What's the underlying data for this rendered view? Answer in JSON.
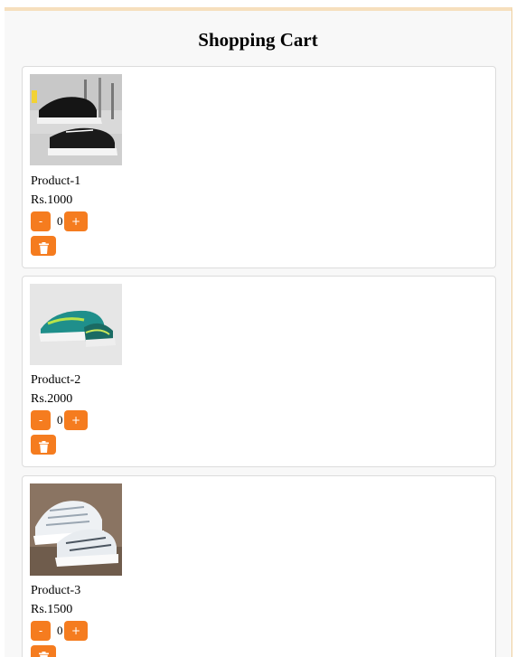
{
  "header": {
    "title": "Shopping Cart"
  },
  "theme": {
    "accent": "#f57c1f",
    "card_border": "#dcdcdc",
    "page_bg": "#f8f8f8"
  },
  "cart": {
    "items": [
      {
        "name": "Product-1",
        "price": "Rs.1000",
        "quantity": "0",
        "minus_label": "-",
        "plus_label": "+",
        "image": "black sneaker with white sole"
      },
      {
        "name": "Product-2",
        "price": "Rs.2000",
        "quantity": "0",
        "minus_label": "-",
        "plus_label": "+",
        "image": "teal and green running shoe"
      },
      {
        "name": "Product-3",
        "price": "Rs.1500",
        "quantity": "0",
        "minus_label": "-",
        "plus_label": "+",
        "image": "white and grey running shoe"
      }
    ]
  },
  "icons": {
    "delete": "trash-icon"
  }
}
